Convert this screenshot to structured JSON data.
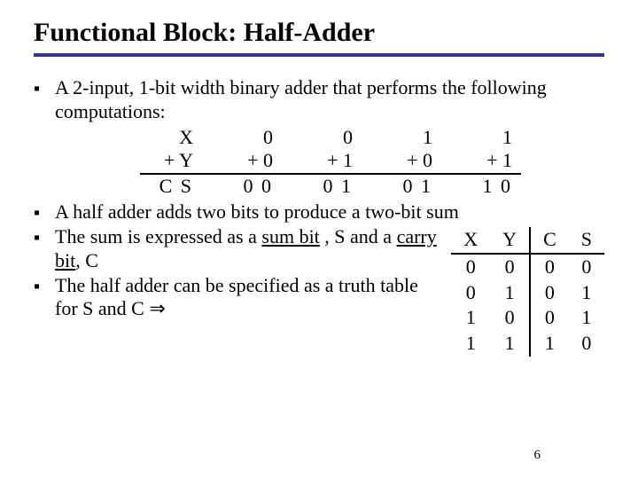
{
  "title": "Functional Block: Half-Adder",
  "bullets": {
    "b1": "A 2-input, 1-bit width binary adder that performs the following computations:",
    "b2": "A half adder adds two bits to produce a two-bit sum",
    "b3_pre": "The sum is expressed as a ",
    "b3_u1": "sum bit",
    "b3_mid": " , S and a ",
    "b3_u2": "carry bit",
    "b3_post": ", C",
    "b4_pre": "The half adder can be specified as a truth table for S and C  ",
    "b4_arrow": "⇒"
  },
  "arith": {
    "row1": {
      "label": "X",
      "c1": "0",
      "c2": "0",
      "c3": "1",
      "c4": "1"
    },
    "row2": {
      "label": "+ Y",
      "c1": "+ 0",
      "c2": "+ 1",
      "c3": "+ 0",
      "c4": "+ 1"
    },
    "row3": {
      "label": "C S",
      "c1": "0 0",
      "c2": "0 1",
      "c3": "0 1",
      "c4": "1 0"
    }
  },
  "truth": {
    "hdr": {
      "x": "X",
      "y": "Y",
      "c": "C",
      "s": "S"
    },
    "rows": [
      {
        "x": "0",
        "y": "0",
        "c": "0",
        "s": "0"
      },
      {
        "x": "0",
        "y": "1",
        "c": "0",
        "s": "1"
      },
      {
        "x": "1",
        "y": "0",
        "c": "0",
        "s": "1"
      },
      {
        "x": "1",
        "y": "1",
        "c": "1",
        "s": "0"
      }
    ]
  },
  "page_number": "6"
}
